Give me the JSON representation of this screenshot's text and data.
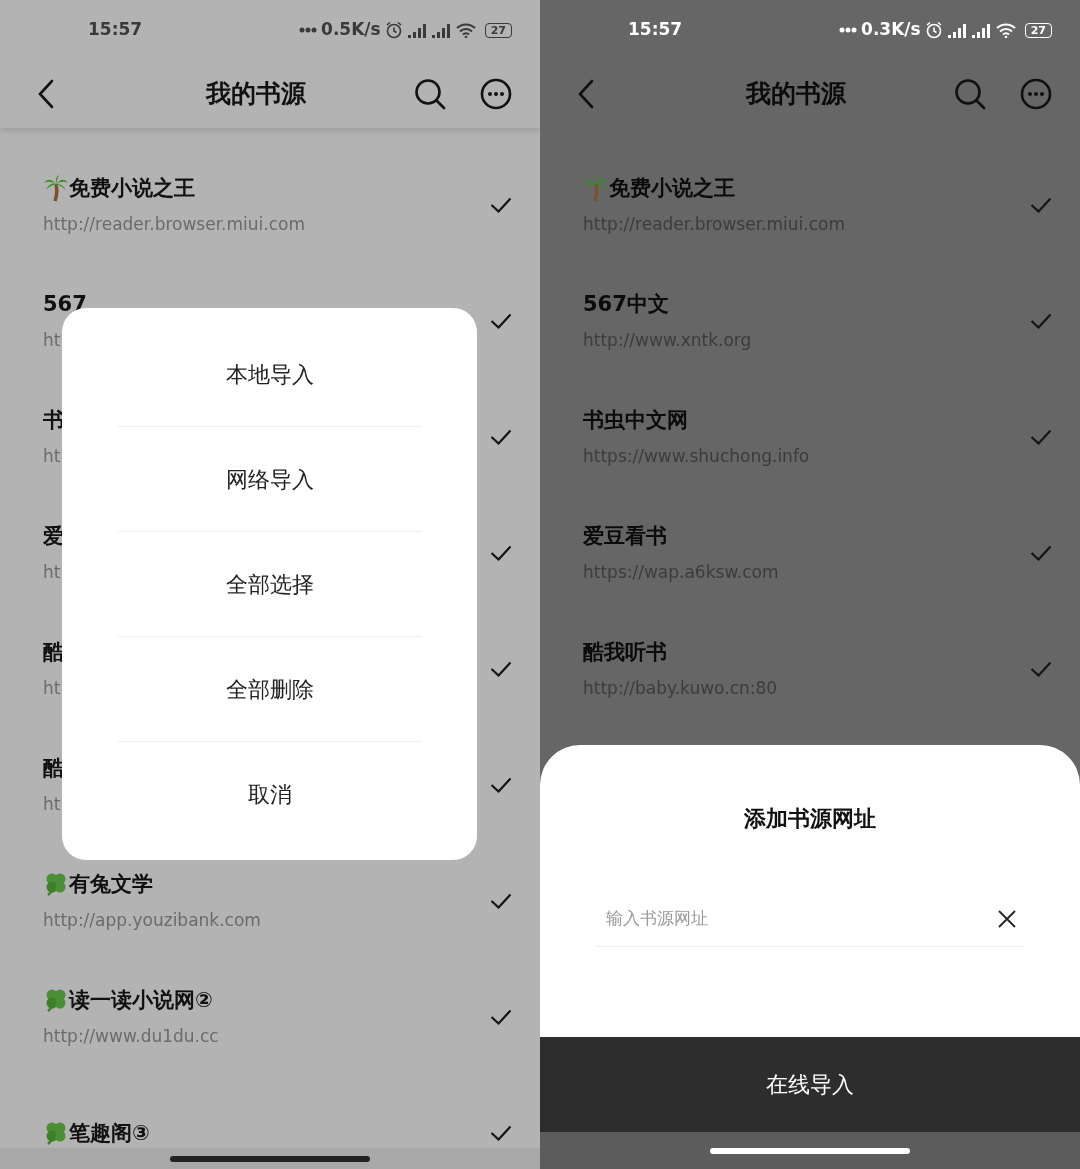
{
  "screens": [
    {
      "kind": "light",
      "status_bar": {
        "time": "15:57",
        "net_speed": "0.5K/s",
        "battery": "27"
      },
      "app_bar": {
        "title": "我的书源"
      },
      "sources": [
        {
          "kind": "palm",
          "title": "免费小说之王",
          "url": "http://reader.browser.miui.com",
          "checked": true
        },
        {
          "title": "567",
          "url": "ht",
          "checked": true
        },
        {
          "title": "书",
          "url": "ht",
          "checked": true
        },
        {
          "title": "爱",
          "url": "ht",
          "checked": true
        },
        {
          "title": "酷",
          "url": "ht",
          "checked": true
        },
        {
          "title": "酷",
          "url": "ht",
          "checked": true
        },
        {
          "kind": "clover",
          "title": "有兔文学",
          "url": "http://app.youzibank.com",
          "checked": true
        },
        {
          "kind": "clover",
          "title": "读一读小说网②",
          "url": "http://www.du1du.cc",
          "checked": true
        },
        {
          "kind": "clover",
          "title": "笔趣阁③",
          "checked": true
        }
      ],
      "dialog": {
        "options": [
          "本地导入",
          "网络导入",
          "全部选择",
          "全部删除",
          "取消"
        ]
      }
    },
    {
      "kind": "dark",
      "status_bar": {
        "time": "15:57",
        "net_speed": "0.3K/s",
        "battery": "27"
      },
      "app_bar": {
        "title": "我的书源"
      },
      "sources": [
        {
          "kind": "palm",
          "title": "免费小说之王",
          "url": "http://reader.browser.miui.com",
          "checked": true
        },
        {
          "title": "567中文",
          "url": "http://www.xntk.org",
          "checked": true
        },
        {
          "title": "书虫中文网",
          "url": "https://www.shuchong.info",
          "checked": true
        },
        {
          "title": "爱豆看书",
          "url": "https://wap.a6ksw.com",
          "checked": true
        },
        {
          "title": "酷我听书",
          "url": "http://baby.kuwo.cn:80",
          "checked": true
        }
      ],
      "sheet": {
        "title": "添加书源网址",
        "input": {
          "placeholder": "输入书源网址"
        },
        "button": "在线导入"
      }
    }
  ]
}
